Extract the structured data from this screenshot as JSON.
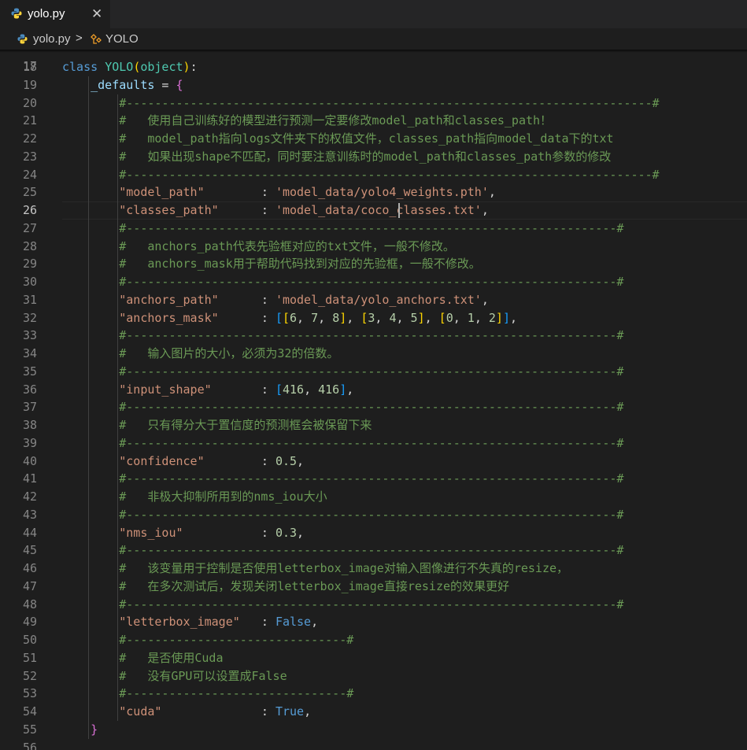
{
  "tab": {
    "file_name": "yolo.py",
    "close_glyph": "✕"
  },
  "breadcrumb": {
    "file": "yolo.py",
    "separator": ">",
    "symbol": "YOLO"
  },
  "editor": {
    "top_partial_line": "17",
    "active_line": 26,
    "lines": [
      {
        "n": 18,
        "tokens": [
          [
            "k",
            "class "
          ],
          [
            "c",
            "YOLO"
          ],
          [
            "br",
            "("
          ],
          [
            "c",
            "object"
          ],
          [
            "br",
            ")"
          ],
          [
            "p",
            ":"
          ]
        ]
      },
      {
        "n": 19,
        "tokens": [
          [
            "p",
            "    "
          ],
          [
            "v",
            "_defaults"
          ],
          [
            "p",
            " = "
          ],
          [
            "br2",
            "{"
          ]
        ]
      },
      {
        "n": 20,
        "tokens": [
          [
            "p",
            "        "
          ],
          [
            "cm",
            "#--------------------------------------------------------------------------#"
          ]
        ]
      },
      {
        "n": 21,
        "tokens": [
          [
            "p",
            "        "
          ],
          [
            "cm",
            "#   使用自己训练好的模型进行预测一定要修改model_path和classes_path！"
          ]
        ]
      },
      {
        "n": 22,
        "tokens": [
          [
            "p",
            "        "
          ],
          [
            "cm",
            "#   model_path指向logs文件夹下的权值文件，classes_path指向model_data下的txt"
          ]
        ]
      },
      {
        "n": 23,
        "tokens": [
          [
            "p",
            "        "
          ],
          [
            "cm",
            "#   如果出现shape不匹配，同时要注意训练时的model_path和classes_path参数的修改"
          ]
        ]
      },
      {
        "n": 24,
        "tokens": [
          [
            "p",
            "        "
          ],
          [
            "cm",
            "#--------------------------------------------------------------------------#"
          ]
        ]
      },
      {
        "n": 25,
        "tokens": [
          [
            "p",
            "        "
          ],
          [
            "s",
            "\"model_path\""
          ],
          [
            "p",
            "        : "
          ],
          [
            "s",
            "'model_data/yolo4_weights.pth'"
          ],
          [
            "p",
            ","
          ]
        ]
      },
      {
        "n": 26,
        "tokens": [
          [
            "p",
            "        "
          ],
          [
            "s",
            "\"classes_path\""
          ],
          [
            "p",
            "      : "
          ],
          [
            "s",
            "'model_data/coco_classes.txt'"
          ],
          [
            "p",
            ","
          ]
        ]
      },
      {
        "n": 27,
        "tokens": [
          [
            "p",
            "        "
          ],
          [
            "cm",
            "#---------------------------------------------------------------------#"
          ]
        ]
      },
      {
        "n": 28,
        "tokens": [
          [
            "p",
            "        "
          ],
          [
            "cm",
            "#   anchors_path代表先验框对应的txt文件，一般不修改。"
          ]
        ]
      },
      {
        "n": 29,
        "tokens": [
          [
            "p",
            "        "
          ],
          [
            "cm",
            "#   anchors_mask用于帮助代码找到对应的先验框，一般不修改。"
          ]
        ]
      },
      {
        "n": 30,
        "tokens": [
          [
            "p",
            "        "
          ],
          [
            "cm",
            "#---------------------------------------------------------------------#"
          ]
        ]
      },
      {
        "n": 31,
        "tokens": [
          [
            "p",
            "        "
          ],
          [
            "s",
            "\"anchors_path\""
          ],
          [
            "p",
            "      : "
          ],
          [
            "s",
            "'model_data/yolo_anchors.txt'"
          ],
          [
            "p",
            ","
          ]
        ]
      },
      {
        "n": 32,
        "tokens": [
          [
            "p",
            "        "
          ],
          [
            "s",
            "\"anchors_mask\""
          ],
          [
            "p",
            "      : "
          ],
          [
            "br3",
            "["
          ],
          [
            "br",
            "["
          ],
          [
            "n",
            "6"
          ],
          [
            "p",
            ", "
          ],
          [
            "n",
            "7"
          ],
          [
            "p",
            ", "
          ],
          [
            "n",
            "8"
          ],
          [
            "br",
            "]"
          ],
          [
            "p",
            ", "
          ],
          [
            "br",
            "["
          ],
          [
            "n",
            "3"
          ],
          [
            "p",
            ", "
          ],
          [
            "n",
            "4"
          ],
          [
            "p",
            ", "
          ],
          [
            "n",
            "5"
          ],
          [
            "br",
            "]"
          ],
          [
            "p",
            ", "
          ],
          [
            "br",
            "["
          ],
          [
            "n",
            "0"
          ],
          [
            "p",
            ", "
          ],
          [
            "n",
            "1"
          ],
          [
            "p",
            ", "
          ],
          [
            "n",
            "2"
          ],
          [
            "br",
            "]"
          ],
          [
            "br3",
            "]"
          ],
          [
            "p",
            ","
          ]
        ]
      },
      {
        "n": 33,
        "tokens": [
          [
            "p",
            "        "
          ],
          [
            "cm",
            "#---------------------------------------------------------------------#"
          ]
        ]
      },
      {
        "n": 34,
        "tokens": [
          [
            "p",
            "        "
          ],
          [
            "cm",
            "#   输入图片的大小，必须为32的倍数。"
          ]
        ]
      },
      {
        "n": 35,
        "tokens": [
          [
            "p",
            "        "
          ],
          [
            "cm",
            "#---------------------------------------------------------------------#"
          ]
        ]
      },
      {
        "n": 36,
        "tokens": [
          [
            "p",
            "        "
          ],
          [
            "s",
            "\"input_shape\""
          ],
          [
            "p",
            "       : "
          ],
          [
            "br3",
            "["
          ],
          [
            "n",
            "416"
          ],
          [
            "p",
            ", "
          ],
          [
            "n",
            "416"
          ],
          [
            "br3",
            "]"
          ],
          [
            "p",
            ","
          ]
        ]
      },
      {
        "n": 37,
        "tokens": [
          [
            "p",
            "        "
          ],
          [
            "cm",
            "#---------------------------------------------------------------------#"
          ]
        ]
      },
      {
        "n": 38,
        "tokens": [
          [
            "p",
            "        "
          ],
          [
            "cm",
            "#   只有得分大于置信度的预测框会被保留下来"
          ]
        ]
      },
      {
        "n": 39,
        "tokens": [
          [
            "p",
            "        "
          ],
          [
            "cm",
            "#---------------------------------------------------------------------#"
          ]
        ]
      },
      {
        "n": 40,
        "tokens": [
          [
            "p",
            "        "
          ],
          [
            "s",
            "\"confidence\""
          ],
          [
            "p",
            "        : "
          ],
          [
            "n",
            "0.5"
          ],
          [
            "p",
            ","
          ]
        ]
      },
      {
        "n": 41,
        "tokens": [
          [
            "p",
            "        "
          ],
          [
            "cm",
            "#---------------------------------------------------------------------#"
          ]
        ]
      },
      {
        "n": 42,
        "tokens": [
          [
            "p",
            "        "
          ],
          [
            "cm",
            "#   非极大抑制所用到的nms_iou大小"
          ]
        ]
      },
      {
        "n": 43,
        "tokens": [
          [
            "p",
            "        "
          ],
          [
            "cm",
            "#---------------------------------------------------------------------#"
          ]
        ]
      },
      {
        "n": 44,
        "tokens": [
          [
            "p",
            "        "
          ],
          [
            "s",
            "\"nms_iou\""
          ],
          [
            "p",
            "           : "
          ],
          [
            "n",
            "0.3"
          ],
          [
            "p",
            ","
          ]
        ]
      },
      {
        "n": 45,
        "tokens": [
          [
            "p",
            "        "
          ],
          [
            "cm",
            "#---------------------------------------------------------------------#"
          ]
        ]
      },
      {
        "n": 46,
        "tokens": [
          [
            "p",
            "        "
          ],
          [
            "cm",
            "#   该变量用于控制是否使用letterbox_image对输入图像进行不失真的resize，"
          ]
        ]
      },
      {
        "n": 47,
        "tokens": [
          [
            "p",
            "        "
          ],
          [
            "cm",
            "#   在多次测试后，发现关闭letterbox_image直接resize的效果更好"
          ]
        ]
      },
      {
        "n": 48,
        "tokens": [
          [
            "p",
            "        "
          ],
          [
            "cm",
            "#---------------------------------------------------------------------#"
          ]
        ]
      },
      {
        "n": 49,
        "tokens": [
          [
            "p",
            "        "
          ],
          [
            "s",
            "\"letterbox_image\""
          ],
          [
            "p",
            "   : "
          ],
          [
            "k",
            "False"
          ],
          [
            "p",
            ","
          ]
        ]
      },
      {
        "n": 50,
        "tokens": [
          [
            "p",
            "        "
          ],
          [
            "cm",
            "#-------------------------------#"
          ]
        ]
      },
      {
        "n": 51,
        "tokens": [
          [
            "p",
            "        "
          ],
          [
            "cm",
            "#   是否使用Cuda"
          ]
        ]
      },
      {
        "n": 52,
        "tokens": [
          [
            "p",
            "        "
          ],
          [
            "cm",
            "#   没有GPU可以设置成False"
          ]
        ]
      },
      {
        "n": 53,
        "tokens": [
          [
            "p",
            "        "
          ],
          [
            "cm",
            "#-------------------------------#"
          ]
        ]
      },
      {
        "n": 54,
        "tokens": [
          [
            "p",
            "        "
          ],
          [
            "s",
            "\"cuda\""
          ],
          [
            "p",
            "              : "
          ],
          [
            "k",
            "True"
          ],
          [
            "p",
            ","
          ]
        ]
      },
      {
        "n": 55,
        "tokens": [
          [
            "p",
            "    "
          ],
          [
            "br2",
            "}"
          ]
        ]
      },
      {
        "n": 56,
        "tokens": []
      }
    ]
  }
}
